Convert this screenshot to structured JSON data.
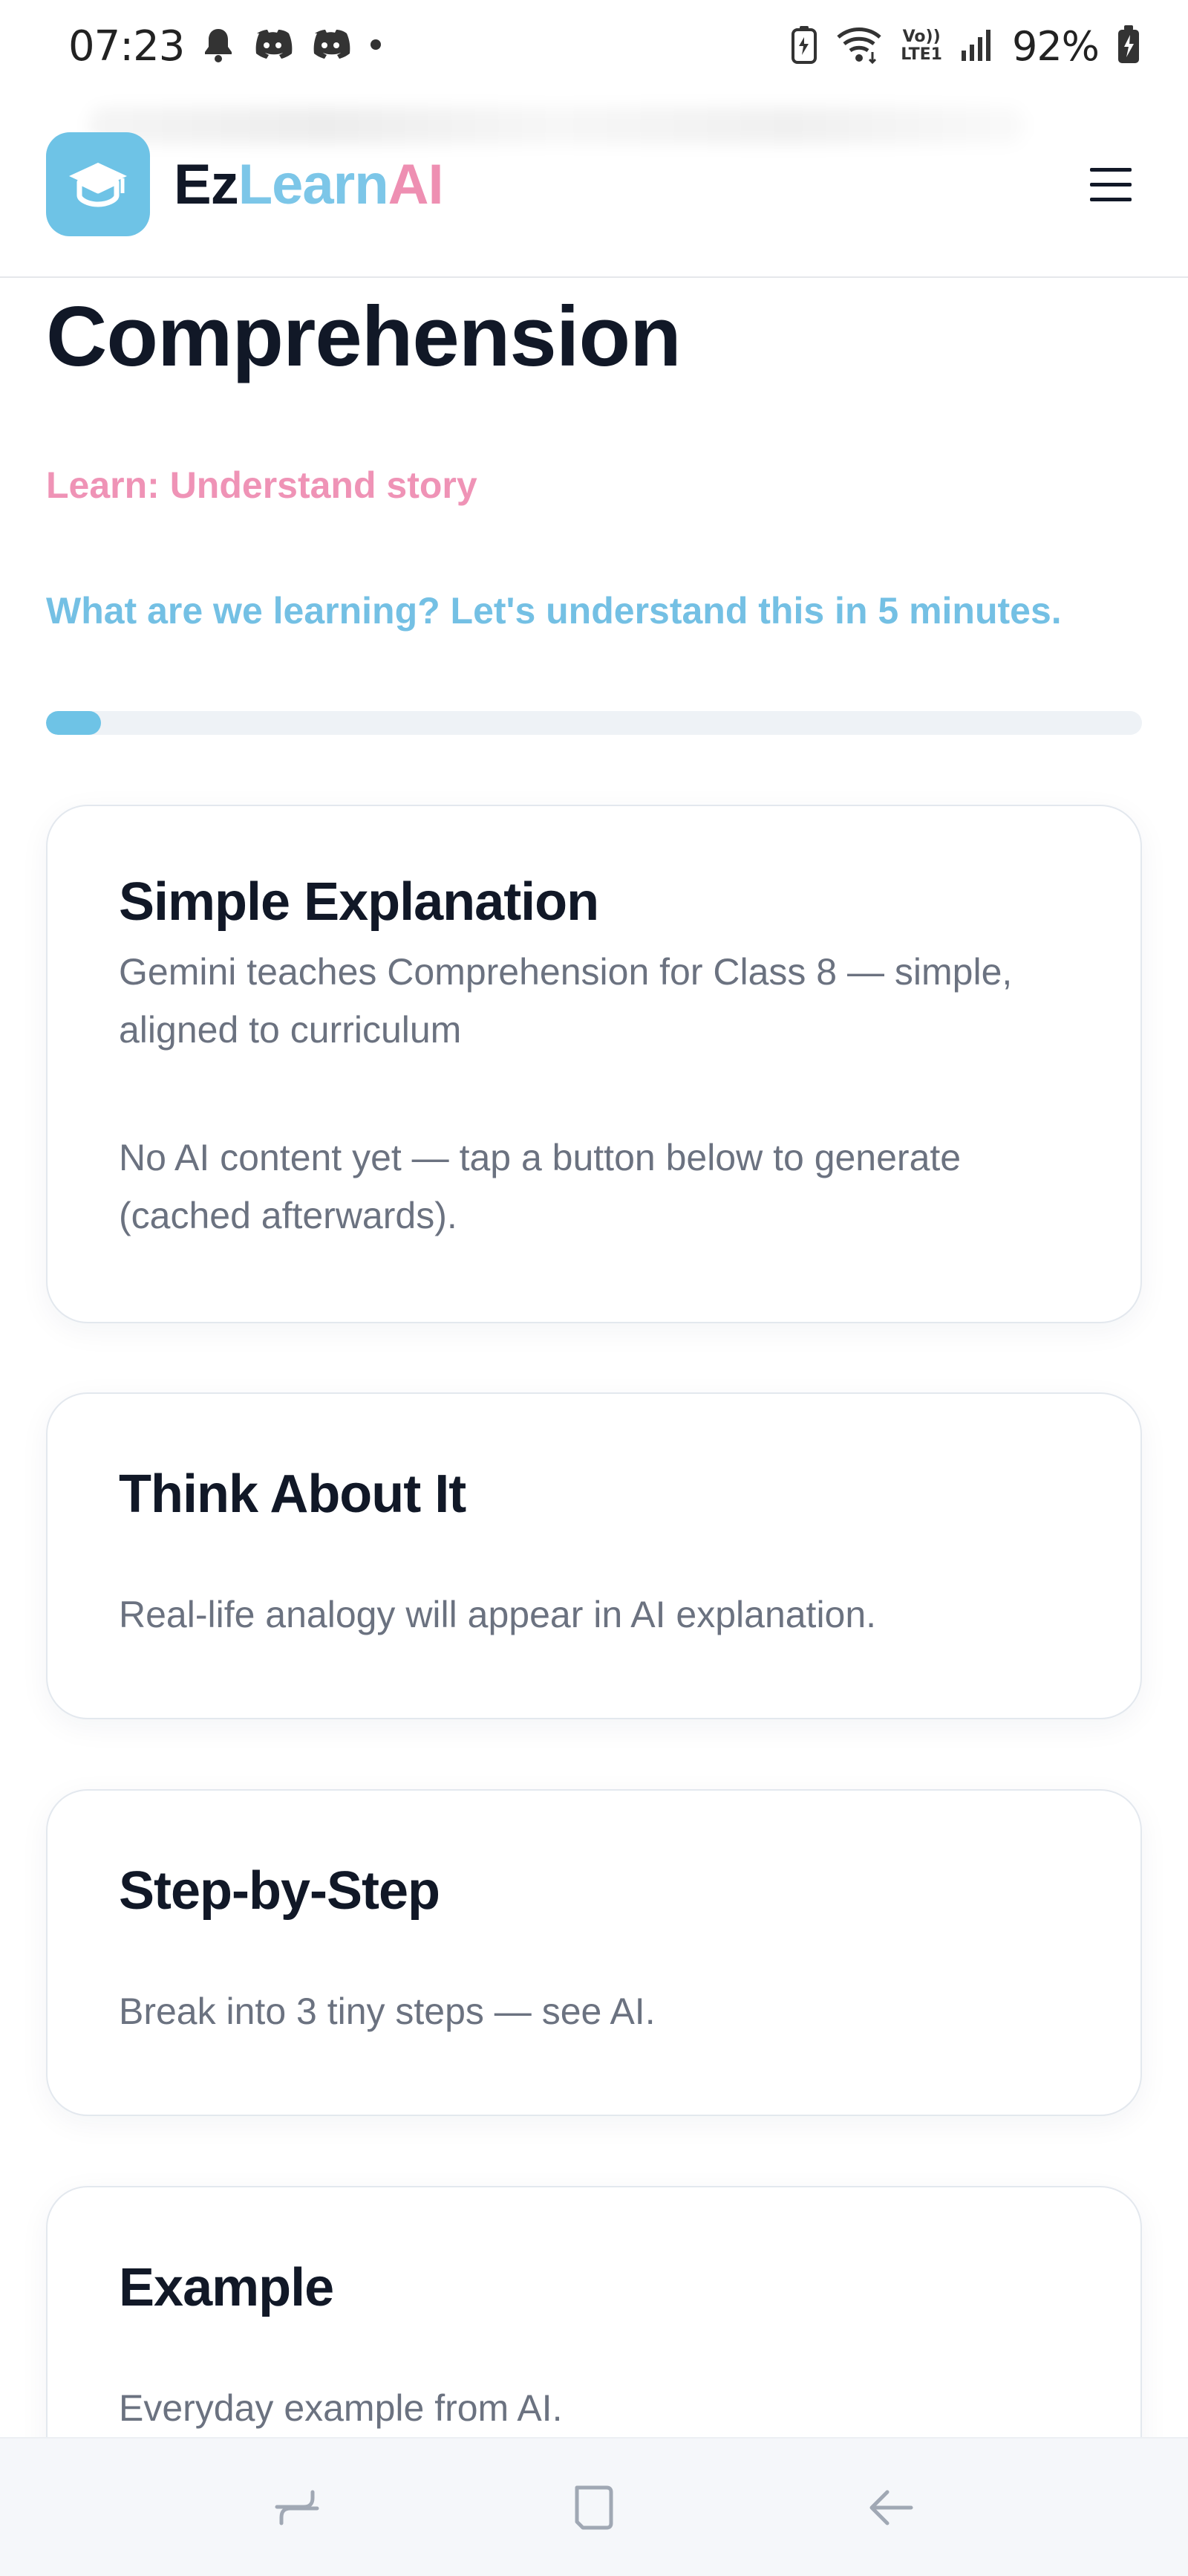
{
  "status_bar": {
    "time": "07:23",
    "battery_percent": "92%",
    "left_icons": [
      "bell-icon",
      "discord-icon",
      "discord-icon",
      "dot-icon"
    ],
    "right_icons": [
      "battery-saver-icon",
      "wifi-icon",
      "volte-icon",
      "signal-icon",
      "battery-charging-icon"
    ],
    "volte_label_top": "Vo))",
    "volte_label_bottom": "LTE1"
  },
  "header": {
    "brand_parts": {
      "ez": "Ez",
      "learn": "Learn",
      "ai": "AI"
    },
    "logo_icon": "graduation-cap-icon",
    "menu_icon": "hamburger-menu-icon"
  },
  "page": {
    "title": "Comprehension",
    "learn_line": "Learn: Understand story",
    "intro_line": "What are we learning? Let's understand this in 5 minutes.",
    "progress": 0.05
  },
  "cards": [
    {
      "title": "Simple Explanation",
      "description": "Gemini teaches Comprehension for Class 8 — simple, aligned to curriculum",
      "note": "No AI content yet — tap a button below to generate (cached afterwards)."
    },
    {
      "title": "Think About It",
      "text": "Real-life analogy will appear in AI explanation."
    },
    {
      "title": "Step-by-Step",
      "text": "Break into 3 tiny steps — see AI."
    },
    {
      "title": "Example",
      "text": "Everyday example from AI."
    }
  ],
  "nav_bar": {
    "buttons": [
      "recent-apps-icon",
      "home-icon",
      "back-icon"
    ]
  },
  "colors": {
    "accent_blue": "#6ec3e6",
    "accent_pink": "#ef93b6",
    "text_dark": "#111827",
    "text_muted": "#6b7280"
  }
}
